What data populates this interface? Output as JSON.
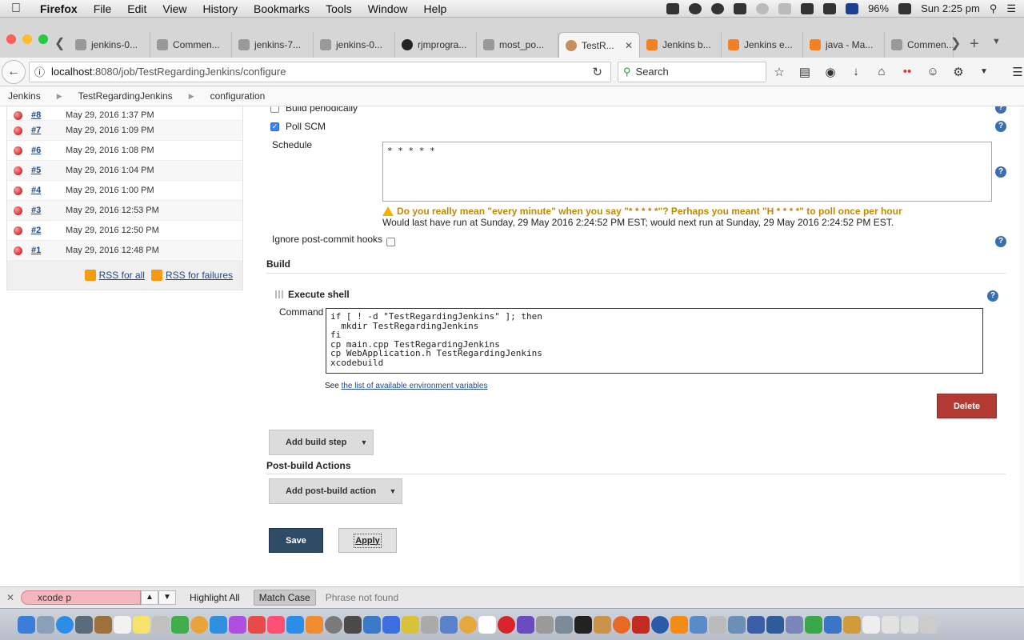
{
  "menubar": {
    "apple": "",
    "items": [
      "Firefox",
      "File",
      "Edit",
      "View",
      "History",
      "Bookmarks",
      "Tools",
      "Window",
      "Help"
    ],
    "battery": "96%",
    "clock": "Sun 2:25 pm"
  },
  "tabs": [
    {
      "label": "jenkins-0...",
      "active": false
    },
    {
      "label": "Commen...",
      "active": false
    },
    {
      "label": "jenkins-7...",
      "active": false
    },
    {
      "label": "jenkins-0...",
      "active": false
    },
    {
      "label": "rjmprogra...",
      "active": false
    },
    {
      "label": "most_po...",
      "active": false
    },
    {
      "label": "TestR...",
      "active": true
    },
    {
      "label": "Jenkins b...",
      "active": false
    },
    {
      "label": "Jenkins e...",
      "active": false
    },
    {
      "label": "java - Ma...",
      "active": false
    },
    {
      "label": "Commen...",
      "active": false
    }
  ],
  "nav": {
    "url_host": "localhost",
    "url_path": ":8080/job/TestRegardingJenkins/configure",
    "search_placeholder": "Search"
  },
  "breadcrumb": [
    "Jenkins",
    "TestRegardingJenkins",
    "configuration"
  ],
  "build_history": {
    "rows": [
      {
        "num": "#8",
        "date": "May 29, 2016 1:37 PM"
      },
      {
        "num": "#7",
        "date": "May 29, 2016 1:09 PM"
      },
      {
        "num": "#6",
        "date": "May 29, 2016 1:08 PM"
      },
      {
        "num": "#5",
        "date": "May 29, 2016 1:04 PM"
      },
      {
        "num": "#4",
        "date": "May 29, 2016 1:00 PM"
      },
      {
        "num": "#3",
        "date": "May 29, 2016 12:53 PM"
      },
      {
        "num": "#2",
        "date": "May 29, 2016 12:50 PM"
      },
      {
        "num": "#1",
        "date": "May 29, 2016 12:48 PM"
      }
    ],
    "rss_all": "RSS for all",
    "rss_failures": "RSS for failures"
  },
  "triggers": {
    "build_periodically": "Build periodically",
    "poll_scm": "Poll SCM",
    "schedule_label": "Schedule",
    "schedule_value": "* * * * *",
    "warning": "Do you really mean \"every minute\" when you say \"* * * * *\"? Perhaps you meant \"H * * * *\" to poll once per hour",
    "run_info": "Would last have run at Sunday, 29 May 2016 2:24:52 PM EST; would next run at Sunday, 29 May 2016 2:24:52 PM EST.",
    "ignore_hooks": "Ignore post-commit hooks"
  },
  "build": {
    "title": "Build",
    "step_title": "Execute shell",
    "command_label": "Command",
    "command": "if [ ! -d \"TestRegardingJenkins\" ]; then\n  mkdir TestRegardingJenkins\nfi\ncp main.cpp TestRegardingJenkins\ncp WebApplication.h TestRegardingJenkins\nxcodebuild",
    "env_prefix": "See ",
    "env_link": "the list of available environment variables",
    "delete": "Delete",
    "add_step": "Add build step"
  },
  "post_build": {
    "title": "Post-build Actions",
    "add_action": "Add post-build action"
  },
  "actions": {
    "save": "Save",
    "apply": "Apply"
  },
  "findbar": {
    "query": "xcode p",
    "highlight_all": "Highlight All",
    "match_case": "Match Case",
    "status": "Phrase not found"
  },
  "colors": {
    "delete": "#b33a32",
    "save": "#2f4c66",
    "accent": "#204a87"
  }
}
